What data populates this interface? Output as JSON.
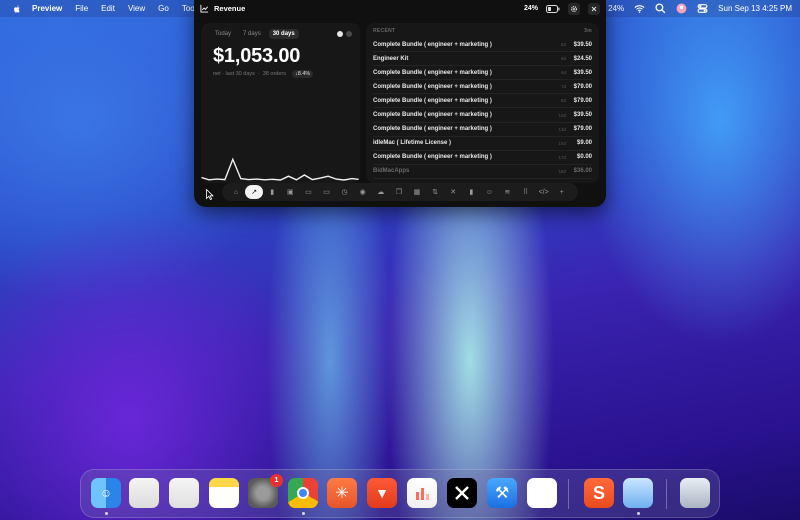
{
  "menubar": {
    "items": [
      "Preview",
      "File",
      "Edit",
      "View",
      "Go",
      "Tools"
    ],
    "battery_left": "24%",
    "battery_right": "24%",
    "clock": "Sun Sep 13  4:25 PM"
  },
  "window": {
    "title": "Revenue",
    "periods": [
      {
        "label": "Today",
        "active": false
      },
      {
        "label": "7 days",
        "active": false
      },
      {
        "label": "30 days",
        "active": true
      }
    ],
    "amount": "$1,053.00",
    "subtitle_period": "net · last 30 days",
    "subtitle_orders": "38 orders",
    "change": "8.4%",
    "sparkline_values": [
      0.15,
      0.05,
      0.08,
      0.06,
      0.9,
      0.1,
      0.06,
      0.08,
      0.05,
      0.07,
      0.04,
      0.2,
      0.05,
      0.25,
      0.06,
      0.12,
      0.2,
      0.08,
      0.04,
      0.1,
      0.06
    ]
  },
  "recent": {
    "header": "RECENT",
    "header_right": "3m",
    "rows": [
      {
        "name": "Complete Bundle ( engineer + marketing )",
        "ago": "5d",
        "price": "$39.50"
      },
      {
        "name": "Engineer Kit",
        "ago": "6d",
        "price": "$24.50"
      },
      {
        "name": "Complete Bundle ( engineer + marketing )",
        "ago": "6d",
        "price": "$39.50"
      },
      {
        "name": "Complete Bundle ( engineer + marketing )",
        "ago": "7d",
        "price": "$79.00"
      },
      {
        "name": "Complete Bundle ( engineer + marketing )",
        "ago": "8d",
        "price": "$79.00"
      },
      {
        "name": "Complete Bundle ( engineer + marketing )",
        "ago": "10d",
        "price": "$39.50"
      },
      {
        "name": "Complete Bundle ( engineer + marketing )",
        "ago": "13d",
        "price": "$79.00"
      },
      {
        "name": "idleMac ( Lifetime License )",
        "ago": "15d",
        "price": "$9.00"
      },
      {
        "name": "Complete Bundle ( engineer + marketing )",
        "ago": "17d",
        "price": "$0.00"
      },
      {
        "name": "BidMacApps",
        "ago": "18d",
        "price": "$36.00"
      }
    ]
  },
  "toolbar": {
    "icons": [
      "home-icon",
      "chart-line-icon",
      "bar-chart-icon",
      "calendar-icon",
      "inbox-icon",
      "folder-icon",
      "timer-icon",
      "database-icon",
      "cloud-icon",
      "documents-icon",
      "grid-table-icon",
      "swap-icon",
      "tools-icon",
      "bookmark-icon",
      "smile-icon",
      "waveform-icon",
      "apps-grid-icon",
      "code-icon",
      "plus-icon"
    ],
    "active_index": 1
  },
  "dock": {
    "apps": [
      "finder-icon",
      "launchpad-icon",
      "stickies-icon",
      "notes-icon",
      "settings-icon",
      "chrome-icon",
      "perplexity-icon",
      "brave-icon",
      "charts-app-icon",
      "x-app-icon",
      "xcode-icon",
      "blank-app-icon",
      "s-app-icon",
      "bottle-app-icon",
      "trash-icon"
    ],
    "settings_badge": "1"
  }
}
